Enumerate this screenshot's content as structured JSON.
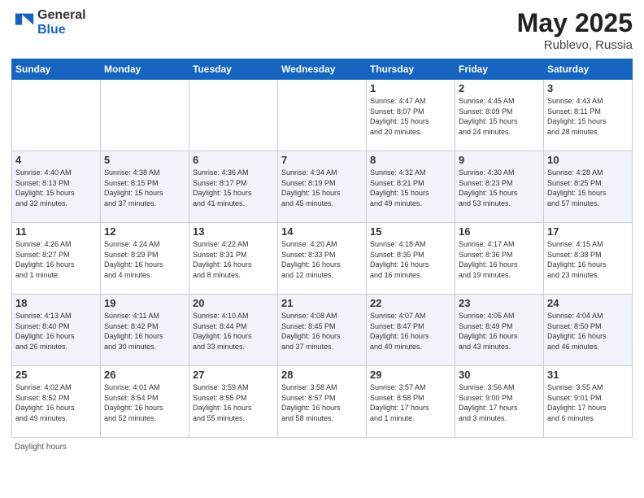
{
  "header": {
    "logo_general": "General",
    "logo_blue": "Blue",
    "month_year": "May 2025",
    "location": "Rublevo, Russia"
  },
  "footer": {
    "daylight_label": "Daylight hours"
  },
  "weekdays": [
    "Sunday",
    "Monday",
    "Tuesday",
    "Wednesday",
    "Thursday",
    "Friday",
    "Saturday"
  ],
  "weeks": [
    [
      {
        "day": "",
        "info": ""
      },
      {
        "day": "",
        "info": ""
      },
      {
        "day": "",
        "info": ""
      },
      {
        "day": "",
        "info": ""
      },
      {
        "day": "1",
        "info": "Sunrise: 4:47 AM\nSunset: 8:07 PM\nDaylight: 15 hours\nand 20 minutes."
      },
      {
        "day": "2",
        "info": "Sunrise: 4:45 AM\nSunset: 8:09 PM\nDaylight: 15 hours\nand 24 minutes."
      },
      {
        "day": "3",
        "info": "Sunrise: 4:43 AM\nSunset: 8:11 PM\nDaylight: 15 hours\nand 28 minutes."
      }
    ],
    [
      {
        "day": "4",
        "info": "Sunrise: 4:40 AM\nSunset: 8:13 PM\nDaylight: 15 hours\nand 32 minutes."
      },
      {
        "day": "5",
        "info": "Sunrise: 4:38 AM\nSunset: 8:15 PM\nDaylight: 15 hours\nand 37 minutes."
      },
      {
        "day": "6",
        "info": "Sunrise: 4:36 AM\nSunset: 8:17 PM\nDaylight: 15 hours\nand 41 minutes."
      },
      {
        "day": "7",
        "info": "Sunrise: 4:34 AM\nSunset: 8:19 PM\nDaylight: 15 hours\nand 45 minutes."
      },
      {
        "day": "8",
        "info": "Sunrise: 4:32 AM\nSunset: 8:21 PM\nDaylight: 15 hours\nand 49 minutes."
      },
      {
        "day": "9",
        "info": "Sunrise: 4:30 AM\nSunset: 8:23 PM\nDaylight: 15 hours\nand 53 minutes."
      },
      {
        "day": "10",
        "info": "Sunrise: 4:28 AM\nSunset: 8:25 PM\nDaylight: 15 hours\nand 57 minutes."
      }
    ],
    [
      {
        "day": "11",
        "info": "Sunrise: 4:26 AM\nSunset: 8:27 PM\nDaylight: 16 hours\nand 1 minute."
      },
      {
        "day": "12",
        "info": "Sunrise: 4:24 AM\nSunset: 8:29 PM\nDaylight: 16 hours\nand 4 minutes."
      },
      {
        "day": "13",
        "info": "Sunrise: 4:22 AM\nSunset: 8:31 PM\nDaylight: 16 hours\nand 8 minutes."
      },
      {
        "day": "14",
        "info": "Sunrise: 4:20 AM\nSunset: 8:33 PM\nDaylight: 16 hours\nand 12 minutes."
      },
      {
        "day": "15",
        "info": "Sunrise: 4:18 AM\nSunset: 8:35 PM\nDaylight: 16 hours\nand 16 minutes."
      },
      {
        "day": "16",
        "info": "Sunrise: 4:17 AM\nSunset: 8:36 PM\nDaylight: 16 hours\nand 19 minutes."
      },
      {
        "day": "17",
        "info": "Sunrise: 4:15 AM\nSunset: 8:38 PM\nDaylight: 16 hours\nand 23 minutes."
      }
    ],
    [
      {
        "day": "18",
        "info": "Sunrise: 4:13 AM\nSunset: 8:40 PM\nDaylight: 16 hours\nand 26 minutes."
      },
      {
        "day": "19",
        "info": "Sunrise: 4:11 AM\nSunset: 8:42 PM\nDaylight: 16 hours\nand 30 minutes."
      },
      {
        "day": "20",
        "info": "Sunrise: 4:10 AM\nSunset: 8:44 PM\nDaylight: 16 hours\nand 33 minutes."
      },
      {
        "day": "21",
        "info": "Sunrise: 4:08 AM\nSunset: 8:45 PM\nDaylight: 16 hours\nand 37 minutes."
      },
      {
        "day": "22",
        "info": "Sunrise: 4:07 AM\nSunset: 8:47 PM\nDaylight: 16 hours\nand 40 minutes."
      },
      {
        "day": "23",
        "info": "Sunrise: 4:05 AM\nSunset: 8:49 PM\nDaylight: 16 hours\nand 43 minutes."
      },
      {
        "day": "24",
        "info": "Sunrise: 4:04 AM\nSunset: 8:50 PM\nDaylight: 16 hours\nand 46 minutes."
      }
    ],
    [
      {
        "day": "25",
        "info": "Sunrise: 4:02 AM\nSunset: 8:52 PM\nDaylight: 16 hours\nand 49 minutes."
      },
      {
        "day": "26",
        "info": "Sunrise: 4:01 AM\nSunset: 8:54 PM\nDaylight: 16 hours\nand 52 minutes."
      },
      {
        "day": "27",
        "info": "Sunrise: 3:59 AM\nSunset: 8:55 PM\nDaylight: 16 hours\nand 55 minutes."
      },
      {
        "day": "28",
        "info": "Sunrise: 3:58 AM\nSunset: 8:57 PM\nDaylight: 16 hours\nand 58 minutes."
      },
      {
        "day": "29",
        "info": "Sunrise: 3:57 AM\nSunset: 8:58 PM\nDaylight: 17 hours\nand 1 minute."
      },
      {
        "day": "30",
        "info": "Sunrise: 3:56 AM\nSunset: 9:00 PM\nDaylight: 17 hours\nand 3 minutes."
      },
      {
        "day": "31",
        "info": "Sunrise: 3:55 AM\nSunset: 9:01 PM\nDaylight: 17 hours\nand 6 minutes."
      }
    ]
  ]
}
